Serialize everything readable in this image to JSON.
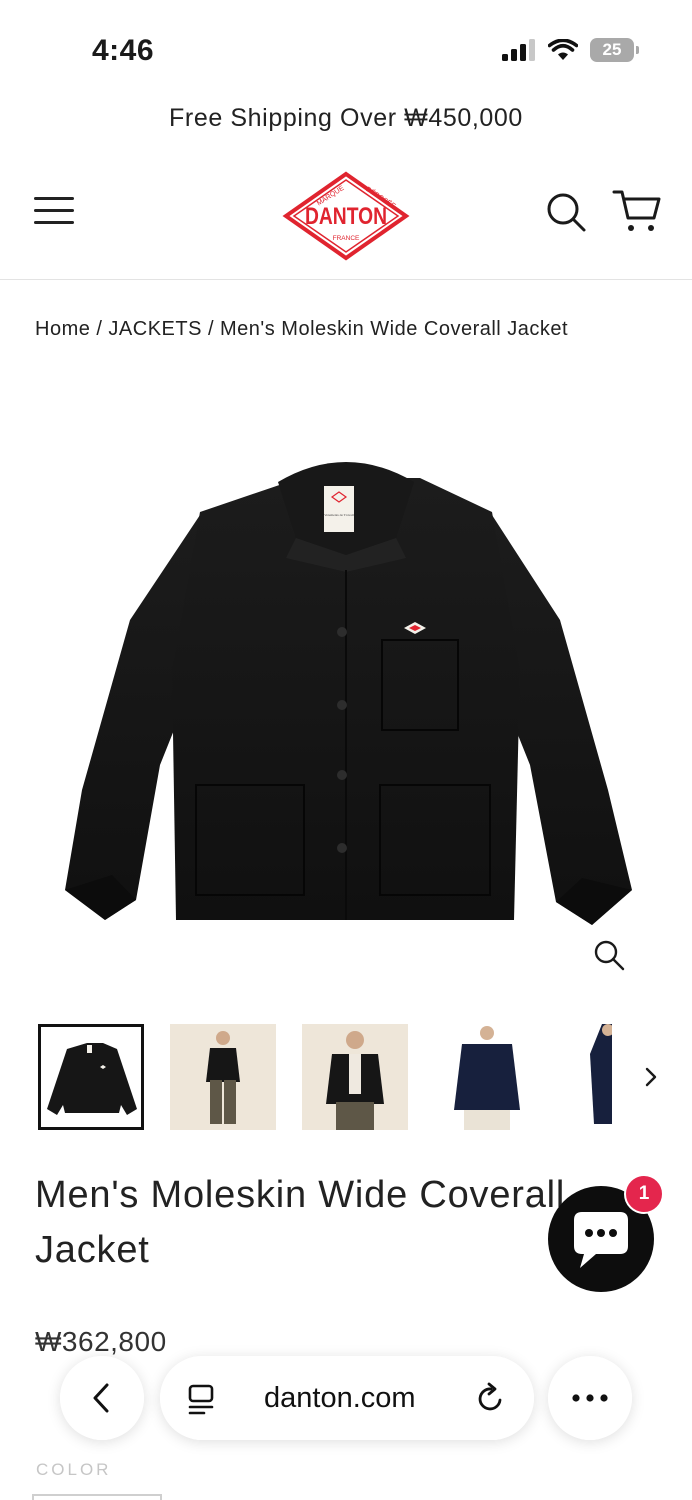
{
  "status_bar": {
    "time": "4:46",
    "battery": "25"
  },
  "announcement": "Free Shipping Over ₩450,000",
  "header": {
    "logo": {
      "top_left": "MARQUE",
      "top_right": "DÉPOSÉE",
      "brand": "DANTON",
      "bottom": "FRANCE"
    }
  },
  "breadcrumb": {
    "home": "Home",
    "separator": "/",
    "category": "JACKETS",
    "current": "Men's Moleskin Wide Coverall Jacket"
  },
  "product": {
    "label_text": "Vetements de Travail",
    "title": "Men's Moleskin Wide Coverall Jacket",
    "price": "₩362,800",
    "color_label": "COLOR"
  },
  "chat": {
    "badge_count": "1"
  },
  "browser": {
    "url": "danton.com"
  },
  "colors": {
    "brand_red": "#e0242f",
    "badge_red": "#e4264d",
    "jacket_black": "#151515",
    "navy": "#17203d"
  }
}
